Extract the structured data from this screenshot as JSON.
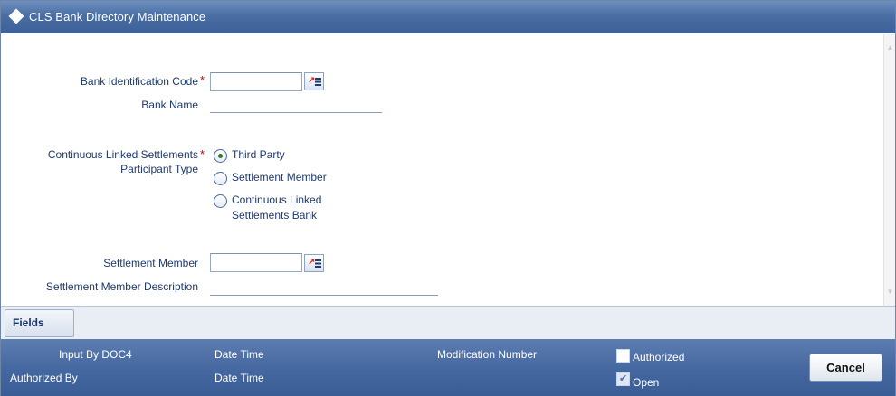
{
  "window": {
    "title": "CLS Bank Directory Maintenance"
  },
  "form": {
    "bank_identification_code": {
      "label": "Bank Identification Code",
      "required_mark": "*",
      "value": ""
    },
    "bank_name": {
      "label": "Bank Name",
      "value": ""
    },
    "participant_type": {
      "label_line1": "Continuous Linked Settlements",
      "label_line2": "Participant Type",
      "required_mark": "*",
      "options": [
        {
          "label": "Third Party",
          "selected": true
        },
        {
          "label": "Settlement Member",
          "selected": false
        },
        {
          "label_line1": "Continuous Linked",
          "label_line2": "Settlements Bank",
          "selected": false
        }
      ]
    },
    "settlement_member": {
      "label": "Settlement Member",
      "value": ""
    },
    "settlement_member_description": {
      "label": "Settlement Member Description",
      "value": ""
    }
  },
  "tabs": {
    "fields": "Fields"
  },
  "footer": {
    "input_by": "Input By DOC4",
    "date_time_1": "Date Time",
    "authorized_by": "Authorized By",
    "date_time_2": "Date Time",
    "modification_number": "Modification Number",
    "authorized": {
      "label": "Authorized",
      "checked": false
    },
    "open": {
      "label": "Open",
      "checked": true
    },
    "cancel": "Cancel"
  },
  "icons": {
    "title": "diamond-icon",
    "lov": "list-of-values-icon"
  },
  "colors": {
    "titlebar": "#4b6fa4",
    "footer": "#44679f",
    "required": "#d40000",
    "label_text": "#1e3a6e"
  }
}
